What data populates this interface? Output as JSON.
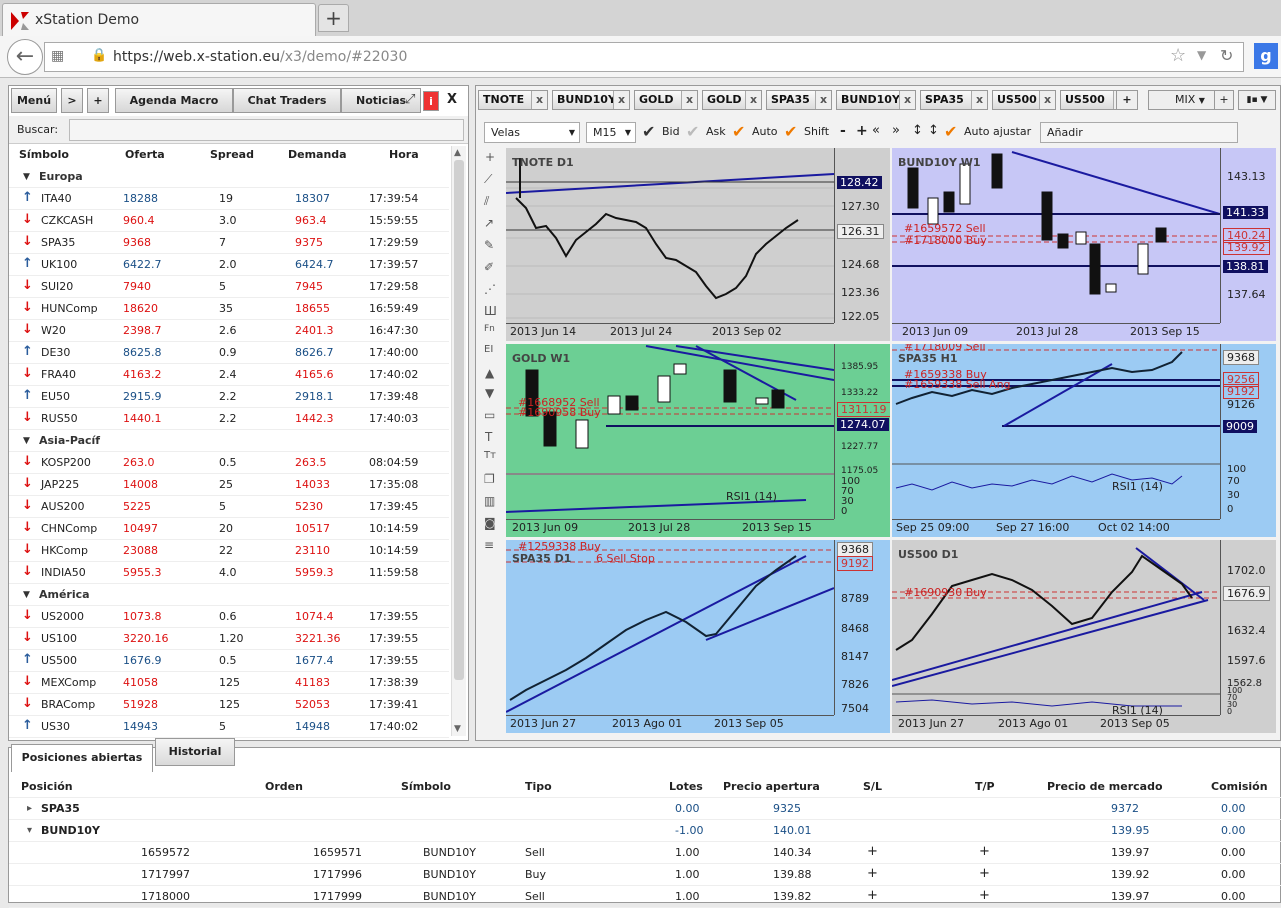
{
  "browser": {
    "tab_title": "xStation Demo",
    "new_tab": "+",
    "url_host": "https://web.x-station.eu",
    "url_path": "/x3/demo/#22030"
  },
  "left_panel": {
    "menu": "Menú",
    "arrow": ">",
    "plus": "+",
    "tabs": [
      "Agenda Macro",
      "Chat Traders",
      "Noticias"
    ],
    "close": "X",
    "info": "i",
    "search_label": "Buscar:",
    "headers": [
      "Símbolo",
      "Oferta",
      "Spread",
      "Demanda",
      "Hora"
    ],
    "groups": [
      "Europa",
      "Asia-Pacíf",
      "América"
    ],
    "rows": [
      {
        "s": "ITA40",
        "o": "18288",
        "sp": "19",
        "d": "18307",
        "h": "17:39:54",
        "dir": "up"
      },
      {
        "s": "CZKCASH",
        "o": "960.4",
        "sp": "3.0",
        "d": "963.4",
        "h": "15:59:55",
        "dir": "down"
      },
      {
        "s": "SPA35",
        "o": "9368",
        "sp": "7",
        "d": "9375",
        "h": "17:29:59",
        "dir": "down"
      },
      {
        "s": "UK100",
        "o": "6422.7",
        "sp": "2.0",
        "d": "6424.7",
        "h": "17:39:57",
        "dir": "up"
      },
      {
        "s": "SUI20",
        "o": "7940",
        "sp": "5",
        "d": "7945",
        "h": "17:29:58",
        "dir": "down"
      },
      {
        "s": "HUNComp",
        "o": "18620",
        "sp": "35",
        "d": "18655",
        "h": "16:59:49",
        "dir": "down"
      },
      {
        "s": "W20",
        "o": "2398.7",
        "sp": "2.6",
        "d": "2401.3",
        "h": "16:47:30",
        "dir": "down"
      },
      {
        "s": "DE30",
        "o": "8625.8",
        "sp": "0.9",
        "d": "8626.7",
        "h": "17:40:00",
        "dir": "up"
      },
      {
        "s": "FRA40",
        "o": "4163.2",
        "sp": "2.4",
        "d": "4165.6",
        "h": "17:40:02",
        "dir": "down"
      },
      {
        "s": "EU50",
        "o": "2915.9",
        "sp": "2.2",
        "d": "2918.1",
        "h": "17:39:48",
        "dir": "up"
      },
      {
        "s": "RUS50",
        "o": "1440.1",
        "sp": "2.2",
        "d": "1442.3",
        "h": "17:40:03",
        "dir": "down"
      },
      {
        "s": "KOSP200",
        "o": "263.0",
        "sp": "0.5",
        "d": "263.5",
        "h": "08:04:59",
        "dir": "down"
      },
      {
        "s": "JAP225",
        "o": "14008",
        "sp": "25",
        "d": "14033",
        "h": "17:35:08",
        "dir": "down"
      },
      {
        "s": "AUS200",
        "o": "5225",
        "sp": "5",
        "d": "5230",
        "h": "17:39:45",
        "dir": "down"
      },
      {
        "s": "CHNComp",
        "o": "10497",
        "sp": "20",
        "d": "10517",
        "h": "10:14:59",
        "dir": "down"
      },
      {
        "s": "HKComp",
        "o": "23088",
        "sp": "22",
        "d": "23110",
        "h": "10:14:59",
        "dir": "down"
      },
      {
        "s": "INDIA50",
        "o": "5955.3",
        "sp": "4.0",
        "d": "5959.3",
        "h": "11:59:58",
        "dir": "down"
      },
      {
        "s": "US2000",
        "o": "1073.8",
        "sp": "0.6",
        "d": "1074.4",
        "h": "17:39:55",
        "dir": "down"
      },
      {
        "s": "US100",
        "o": "3220.16",
        "sp": "1.20",
        "d": "3221.36",
        "h": "17:39:55",
        "dir": "down"
      },
      {
        "s": "US500",
        "o": "1676.9",
        "sp": "0.5",
        "d": "1677.4",
        "h": "17:39:55",
        "dir": "up"
      },
      {
        "s": "MEXComp",
        "o": "41058",
        "sp": "125",
        "d": "41183",
        "h": "17:38:39",
        "dir": "down"
      },
      {
        "s": "BRAComp",
        "o": "51928",
        "sp": "125",
        "d": "52053",
        "h": "17:39:41",
        "dir": "down"
      },
      {
        "s": "US30",
        "o": "14943",
        "sp": "5",
        "d": "14948",
        "h": "17:40:02",
        "dir": "up"
      }
    ]
  },
  "instrument_tabs": [
    "TNOTE",
    "BUND10Y",
    "GOLD",
    "GOLD",
    "SPA35",
    "BUND10Y",
    "SPA35",
    "US500",
    "US500"
  ],
  "instrument_add": "+",
  "layout": {
    "mix": "MIX",
    "plus": "+"
  },
  "chart_toolbar": {
    "type": "Velas",
    "tf": "M15",
    "bid": "Bid",
    "ask": "Ask",
    "auto": "Auto",
    "shift": "Shift",
    "ops": [
      "-",
      "+",
      "«",
      "»",
      "↕",
      "↕"
    ],
    "auto_adjust": "Auto ajustar",
    "add": "Añadir"
  },
  "charts": [
    {
      "title": "TNOTE D1",
      "axis": [
        "128.42",
        "127.30",
        "126.31",
        "124.68",
        "123.36",
        "122.05"
      ],
      "dates": [
        "2013 Jun 14",
        "2013 Jul 24",
        "2013 Sep 02"
      ]
    },
    {
      "title": "BUND10Y W1",
      "axis": [
        "143.13",
        "141.33",
        "140.24",
        "139.92",
        "138.81",
        "137.64"
      ],
      "dates": [
        "2013 Jun 09",
        "2013 Jul 28",
        "2013 Sep 15"
      ],
      "orders": [
        "#1659572 Sell",
        "#1718000 Buy"
      ]
    },
    {
      "title": "GOLD W1",
      "axis": [
        "1385.95",
        "1333.22",
        "1311.19",
        "1274.07",
        "1227.77",
        "1175.05"
      ],
      "dates": [
        "2013 Jun 09",
        "2013 Jul 28",
        "2013 Sep 15"
      ],
      "orders": [
        "#1668952 Sell",
        "#1690958 Buy"
      ],
      "rsi": "RSI1 (14)",
      "rsi_axis": [
        "100",
        "70",
        "30",
        "0"
      ]
    },
    {
      "title": "SPA35 H1",
      "axis": [
        "9368",
        "9256",
        "9192",
        "9126",
        "9009"
      ],
      "dates": [
        "Sep 25 09:00",
        "Sep 27 16:00",
        "Oct 02 14:00"
      ],
      "orders": [
        "#1718009 Sell",
        "#1659338 Buy",
        "#1659338 Sell Ang"
      ],
      "rsi": "RSI1 (14)",
      "rsi_axis": [
        "100",
        "70",
        "30",
        "0"
      ]
    },
    {
      "title": "SPA35 D1",
      "axis": [
        "9368",
        "9192",
        "8789",
        "8468",
        "8147",
        "7826",
        "7504"
      ],
      "dates": [
        "2013 Jun 27",
        "2013 Ago 01",
        "2013 Sep 05"
      ],
      "orders": [
        "#1259338 Buy",
        "6 Sell Stop"
      ]
    },
    {
      "title": "US500 D1",
      "axis": [
        "1702.0",
        "1676.9",
        "1632.4",
        "1597.6",
        "1562.8"
      ],
      "dates": [
        "2013 Jun 27",
        "2013 Ago 01",
        "2013 Sep 05"
      ],
      "orders": [
        "#1690930 Buy"
      ],
      "rsi": "RSI1 (14)",
      "rsi_axis": [
        "100",
        "70",
        "30",
        "0"
      ]
    }
  ],
  "bottom": {
    "tabs": [
      "Posiciones abiertas",
      "Historial"
    ],
    "headers": [
      "Posición",
      "Orden",
      "Símbolo",
      "Tipo",
      "Lotes",
      "Precio apertura",
      "S/L",
      "T/P",
      "Precio de mercado",
      "Comisión"
    ],
    "rows": [
      {
        "pos": "SPA35",
        "ord": "",
        "sym": "",
        "tipo": "",
        "lotes": "0.00",
        "pa": "9325",
        "sl": "",
        "tp": "",
        "pm": "9372",
        "com": "0.00",
        "group": true,
        "exp": "▸"
      },
      {
        "pos": "BUND10Y",
        "ord": "",
        "sym": "",
        "tipo": "",
        "lotes": "-1.00",
        "pa": "140.01",
        "sl": "",
        "tp": "",
        "pm": "139.95",
        "com": "0.00",
        "group": true,
        "exp": "▾"
      },
      {
        "pos": "1659572",
        "ord": "1659571",
        "sym": "BUND10Y",
        "tipo": "Sell",
        "lotes": "1.00",
        "pa": "140.34",
        "sl": "+",
        "tp": "+",
        "pm": "139.97",
        "com": "0.00"
      },
      {
        "pos": "1717997",
        "ord": "1717996",
        "sym": "BUND10Y",
        "tipo": "Buy",
        "lotes": "1.00",
        "pa": "139.88",
        "sl": "+",
        "tp": "+",
        "pm": "139.92",
        "com": "0.00"
      },
      {
        "pos": "1718000",
        "ord": "1717999",
        "sym": "BUND10Y",
        "tipo": "Sell",
        "lotes": "1.00",
        "pa": "139.82",
        "sl": "+",
        "tp": "+",
        "pm": "139.97",
        "com": "0.00"
      }
    ]
  }
}
